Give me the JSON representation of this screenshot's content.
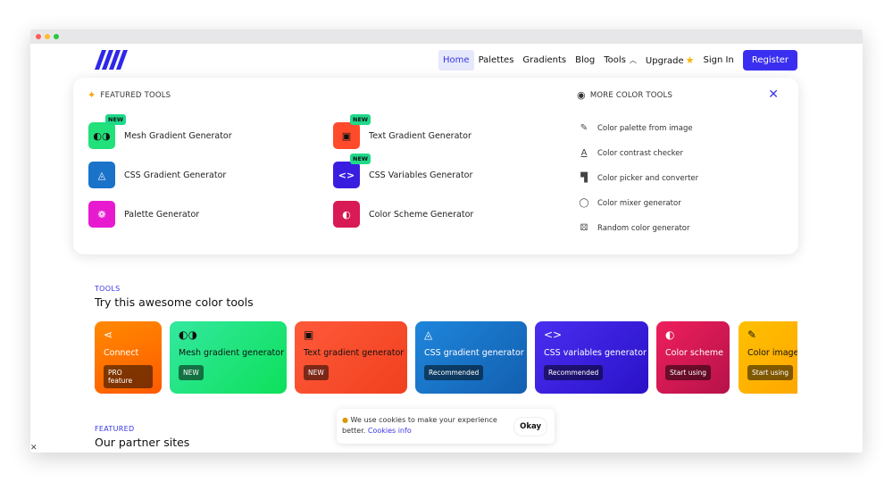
{
  "nav": {
    "items": [
      "Home",
      "Palettes",
      "Gradients",
      "Blog",
      "Tools",
      "Upgrade"
    ],
    "sign_in": "Sign In",
    "register": "Register"
  },
  "dropdown": {
    "featured_title": "FEATURED TOOLS",
    "more_title": "MORE COLOR TOOLS",
    "new_badge": "NEW",
    "featured": [
      {
        "label": "Mesh Gradient Generator",
        "new": true,
        "color": "#22e07a"
      },
      {
        "label": "Text Gradient Generator",
        "new": true,
        "color": "#ff4b2b"
      },
      {
        "label": "CSS Gradient Generator",
        "new": false,
        "color": "#1a73c9"
      },
      {
        "label": "CSS Variables Generator",
        "new": true,
        "color": "#3a1ee0"
      },
      {
        "label": "Palette Generator",
        "new": false,
        "color": "#e81ad0"
      },
      {
        "label": "Color Scheme Generator",
        "new": false,
        "color": "#d81a55"
      }
    ],
    "more": [
      {
        "label": "Color palette from image",
        "icon": "eyedropper-icon"
      },
      {
        "label": "Color contrast checker",
        "icon": "text-a-icon"
      },
      {
        "label": "Color picker and converter",
        "icon": "paint-roller-icon"
      },
      {
        "label": "Color mixer generator",
        "icon": "circles-icon"
      },
      {
        "label": "Random color generator",
        "icon": "dice-icon"
      }
    ]
  },
  "tools_section": {
    "kicker": "TOOLS",
    "heading": "Try this awesome color tools",
    "cards": [
      {
        "title": "Connect",
        "badge": "PRO feature"
      },
      {
        "title": "Mesh gradient generator",
        "badge": "NEW"
      },
      {
        "title": "Text gradient generator",
        "badge": "NEW"
      },
      {
        "title": "CSS gradient generator",
        "badge": "Recommended"
      },
      {
        "title": "CSS variables generator",
        "badge": "Recommended"
      },
      {
        "title": "Color scheme",
        "badge": "Start using"
      },
      {
        "title": "Color image",
        "badge": "Start using"
      }
    ]
  },
  "featured_section": {
    "kicker": "FEATURED",
    "heading": "Our partner sites"
  },
  "cookie": {
    "text": "We use cookies to make your experience better.",
    "link": "Cookies info",
    "button": "Okay"
  },
  "colors": {
    "accent": "#3a2ff0",
    "close": "#3a35e8"
  }
}
